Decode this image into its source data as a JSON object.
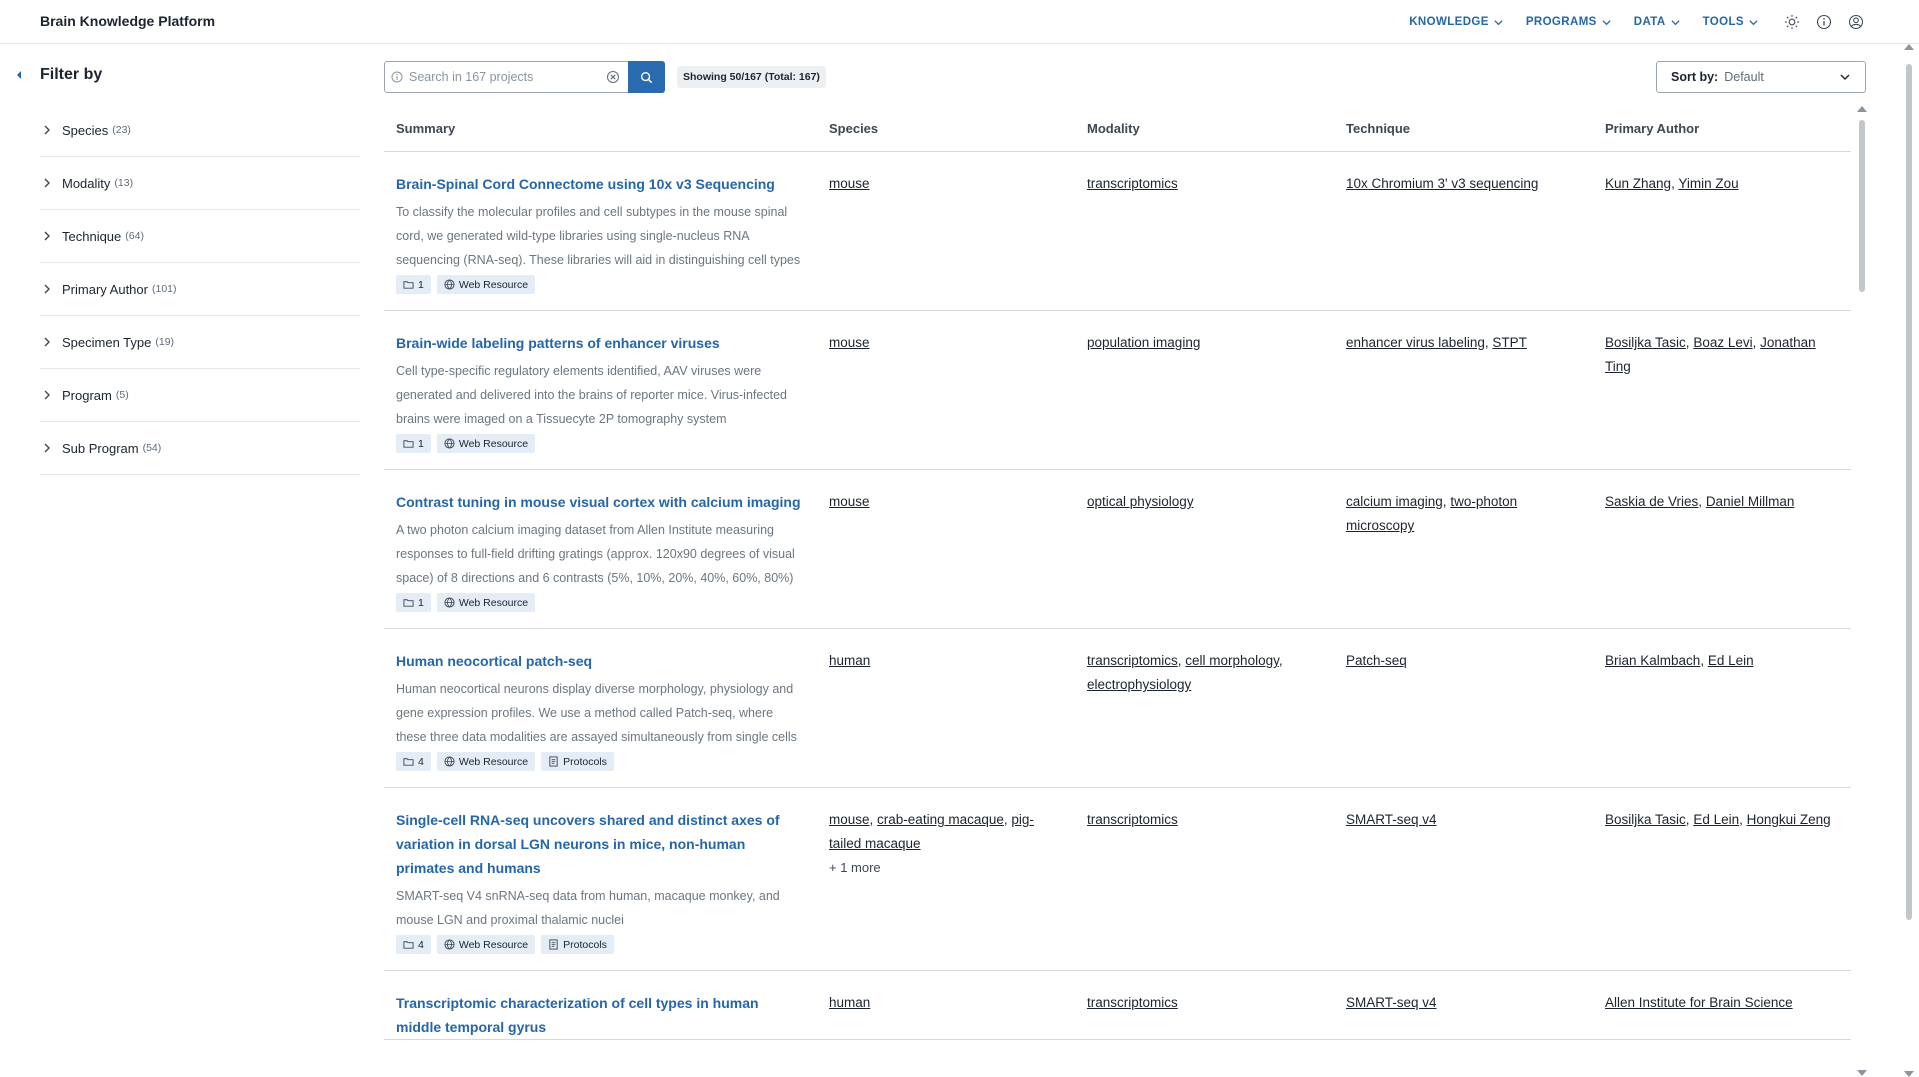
{
  "app": {
    "title": "Brain Knowledge Platform"
  },
  "nav": {
    "items": [
      {
        "label": "KNOWLEDGE"
      },
      {
        "label": "PROGRAMS"
      },
      {
        "label": "DATA"
      },
      {
        "label": "TOOLS"
      }
    ],
    "icons": [
      "sun-icon",
      "info-icon",
      "user-circle-icon"
    ]
  },
  "sidebar": {
    "title": "Filter by",
    "facets": [
      {
        "label": "Species",
        "count": "(23)"
      },
      {
        "label": "Modality",
        "count": "(13)"
      },
      {
        "label": "Technique",
        "count": "(64)"
      },
      {
        "label": "Primary Author",
        "count": "(101)"
      },
      {
        "label": "Specimen Type",
        "count": "(19)"
      },
      {
        "label": "Program",
        "count": "(5)"
      },
      {
        "label": "Sub Program",
        "count": "(54)"
      }
    ]
  },
  "search": {
    "placeholder": "Search in 167 projects",
    "value": ""
  },
  "results": {
    "showing": "Showing 50/167 (Total: 167)"
  },
  "sort": {
    "label": "Sort by:",
    "value": "Default"
  },
  "table": {
    "columns": [
      "Summary",
      "Species",
      "Modality",
      "Technique",
      "Primary Author"
    ],
    "rows": [
      {
        "title": "Brain-Spinal Cord Connectome using 10x v3 Sequencing",
        "description": "To classify the molecular profiles and cell subtypes in the mouse spinal cord, we generated wild-type libraries using single-nucleus RNA sequencing (RNA-seq). These libraries will aid in distinguishing cell types",
        "count": "1",
        "badges": [
          "Web Resource"
        ],
        "species": [
          "mouse"
        ],
        "species_more": "",
        "modality": [
          "transcriptomics"
        ],
        "technique": [
          "10x Chromium 3' v3 sequencing"
        ],
        "authors": [
          "Kun Zhang",
          "Yimin Zou"
        ]
      },
      {
        "title": "Brain-wide labeling patterns of enhancer viruses",
        "description": "Cell type-specific regulatory elements identified, AAV viruses were generated and delivered into the brains of reporter mice. Virus-infected brains were imaged on a Tissuecyte 2P tomography system",
        "count": "1",
        "badges": [
          "Web Resource"
        ],
        "species": [
          "mouse"
        ],
        "species_more": "",
        "modality": [
          "population imaging"
        ],
        "technique": [
          "enhancer virus labeling",
          "STPT"
        ],
        "authors": [
          "Bosiljka Tasic",
          "Boaz Levi",
          "Jonathan Ting"
        ]
      },
      {
        "title": "Contrast tuning in mouse visual cortex with calcium imaging",
        "description": "A two photon calcium imaging dataset from Allen Institute measuring responses to full-field drifting gratings (approx. 120x90 degrees of visual space) of 8 directions and 6 contrasts (5%, 10%, 20%, 40%, 60%, 80%)",
        "count": "1",
        "badges": [
          "Web Resource"
        ],
        "species": [
          "mouse"
        ],
        "species_more": "",
        "modality": [
          "optical physiology"
        ],
        "technique": [
          "calcium imaging",
          "two-photon microscopy"
        ],
        "authors": [
          "Saskia de Vries",
          "Daniel Millman"
        ]
      },
      {
        "title": "Human neocortical patch-seq",
        "description": "Human neocortical neurons display diverse morphology, physiology and gene expression profiles. We use a method called Patch-seq, where these three data modalities are assayed simultaneously from single cells",
        "count": "4",
        "badges": [
          "Web Resource",
          "Protocols"
        ],
        "species": [
          "human"
        ],
        "species_more": "",
        "modality": [
          "transcriptomics",
          "cell morphology",
          "electrophysiology"
        ],
        "technique": [
          "Patch-seq"
        ],
        "authors": [
          "Brian Kalmbach",
          "Ed Lein"
        ]
      },
      {
        "title": "Single-cell RNA-seq uncovers shared and distinct axes of variation in dorsal LGN neurons in mice, non-human primates and humans",
        "description": "SMART-seq V4 snRNA-seq data from human, macaque monkey, and mouse LGN and proximal thalamic nuclei",
        "count": "4",
        "badges": [
          "Web Resource",
          "Protocols"
        ],
        "species": [
          "mouse",
          "crab-eating macaque",
          "pig-tailed macaque"
        ],
        "species_more": "+ 1 more",
        "modality": [
          "transcriptomics"
        ],
        "technique": [
          "SMART-seq v4"
        ],
        "authors": [
          "Bosiljka Tasic",
          "Ed Lein",
          "Hongkui Zeng"
        ]
      },
      {
        "title": "Transcriptomic characterization of cell types in human middle temporal gyrus",
        "description": "",
        "count": "",
        "badges": [],
        "species": [
          "human"
        ],
        "species_more": "",
        "modality": [
          "transcriptomics"
        ],
        "technique": [
          "SMART-seq v4"
        ],
        "authors": [
          "Allen Institute for Brain Science"
        ]
      }
    ]
  },
  "colors": {
    "accent": "#2a6bb0",
    "link_title": "#2566a8",
    "badge_bg": "#e4ecf6",
    "border": "#d5dae0"
  }
}
